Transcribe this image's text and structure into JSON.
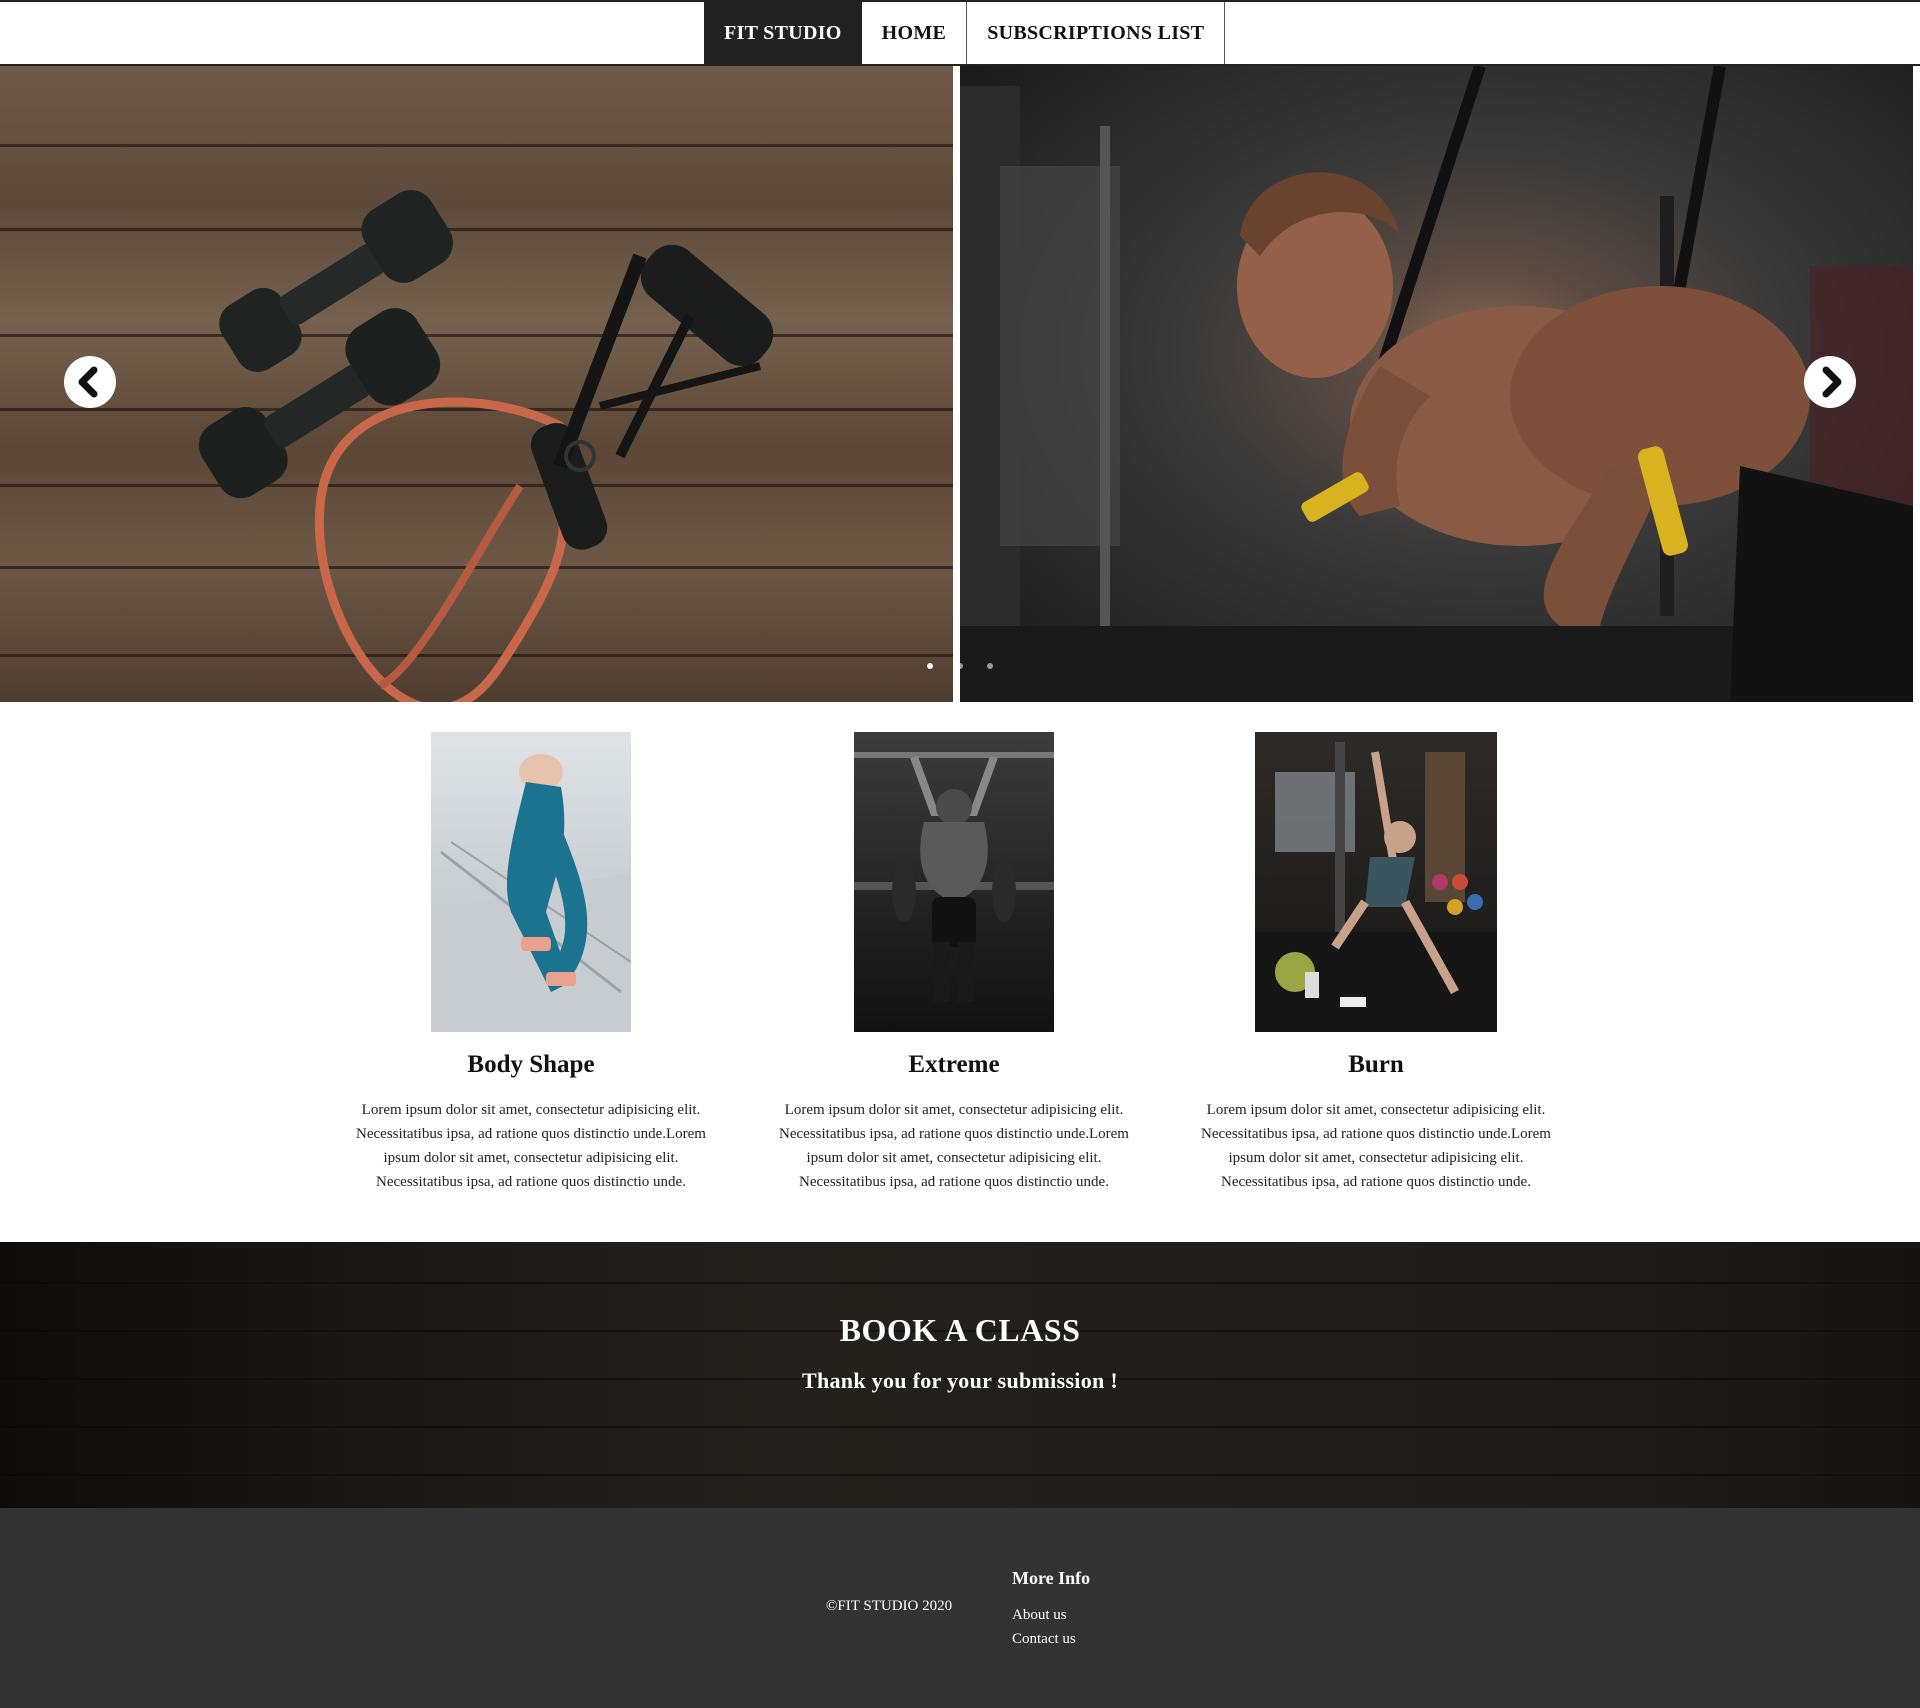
{
  "navbar": {
    "brand": "FIT STUDIO",
    "items": [
      {
        "label": "HOME"
      },
      {
        "label": "SUBSCRIPTIONS LIST"
      }
    ]
  },
  "hero": {
    "slides": [
      {
        "subject": "dumbbells-and-resistance-band"
      },
      {
        "subject": "athlete-on-suspension-trainer"
      }
    ],
    "prev_icon": "chevron-left-icon",
    "next_icon": "chevron-right-icon",
    "indicator_count": 3,
    "active_indicator": 1
  },
  "classes": [
    {
      "title": "Body Shape",
      "description": "Lorem ipsum dolor sit amet, consectetur adipisicing elit. Necessitatibus ipsa, ad ratione quos distinctio unde.Lorem ipsum dolor sit amet, consectetur adipisicing elit. Necessitatibus ipsa, ad ratione quos distinctio unde."
    },
    {
      "title": "Extreme",
      "description": "Lorem ipsum dolor sit amet, consectetur adipisicing elit. Necessitatibus ipsa, ad ratione quos distinctio unde.Lorem ipsum dolor sit amet, consectetur adipisicing elit. Necessitatibus ipsa, ad ratione quos distinctio unde."
    },
    {
      "title": "Burn",
      "description": "Lorem ipsum dolor sit amet, consectetur adipisicing elit. Necessitatibus ipsa, ad ratione quos distinctio unde.Lorem ipsum dolor sit amet, consectetur adipisicing elit. Necessitatibus ipsa, ad ratione quos distinctio unde."
    }
  ],
  "book": {
    "title": "BOOK A CLASS",
    "message": "Thank you for your submission !"
  },
  "footer": {
    "copyright": "©FIT STUDIO 2020",
    "more_info": {
      "title": "More Info",
      "links": [
        {
          "label": "About us"
        },
        {
          "label": "Contact us"
        }
      ]
    }
  },
  "colors": {
    "brand_bg": "#222222",
    "footer_bg": "#333333",
    "book_bg": "#1e1c1a"
  }
}
